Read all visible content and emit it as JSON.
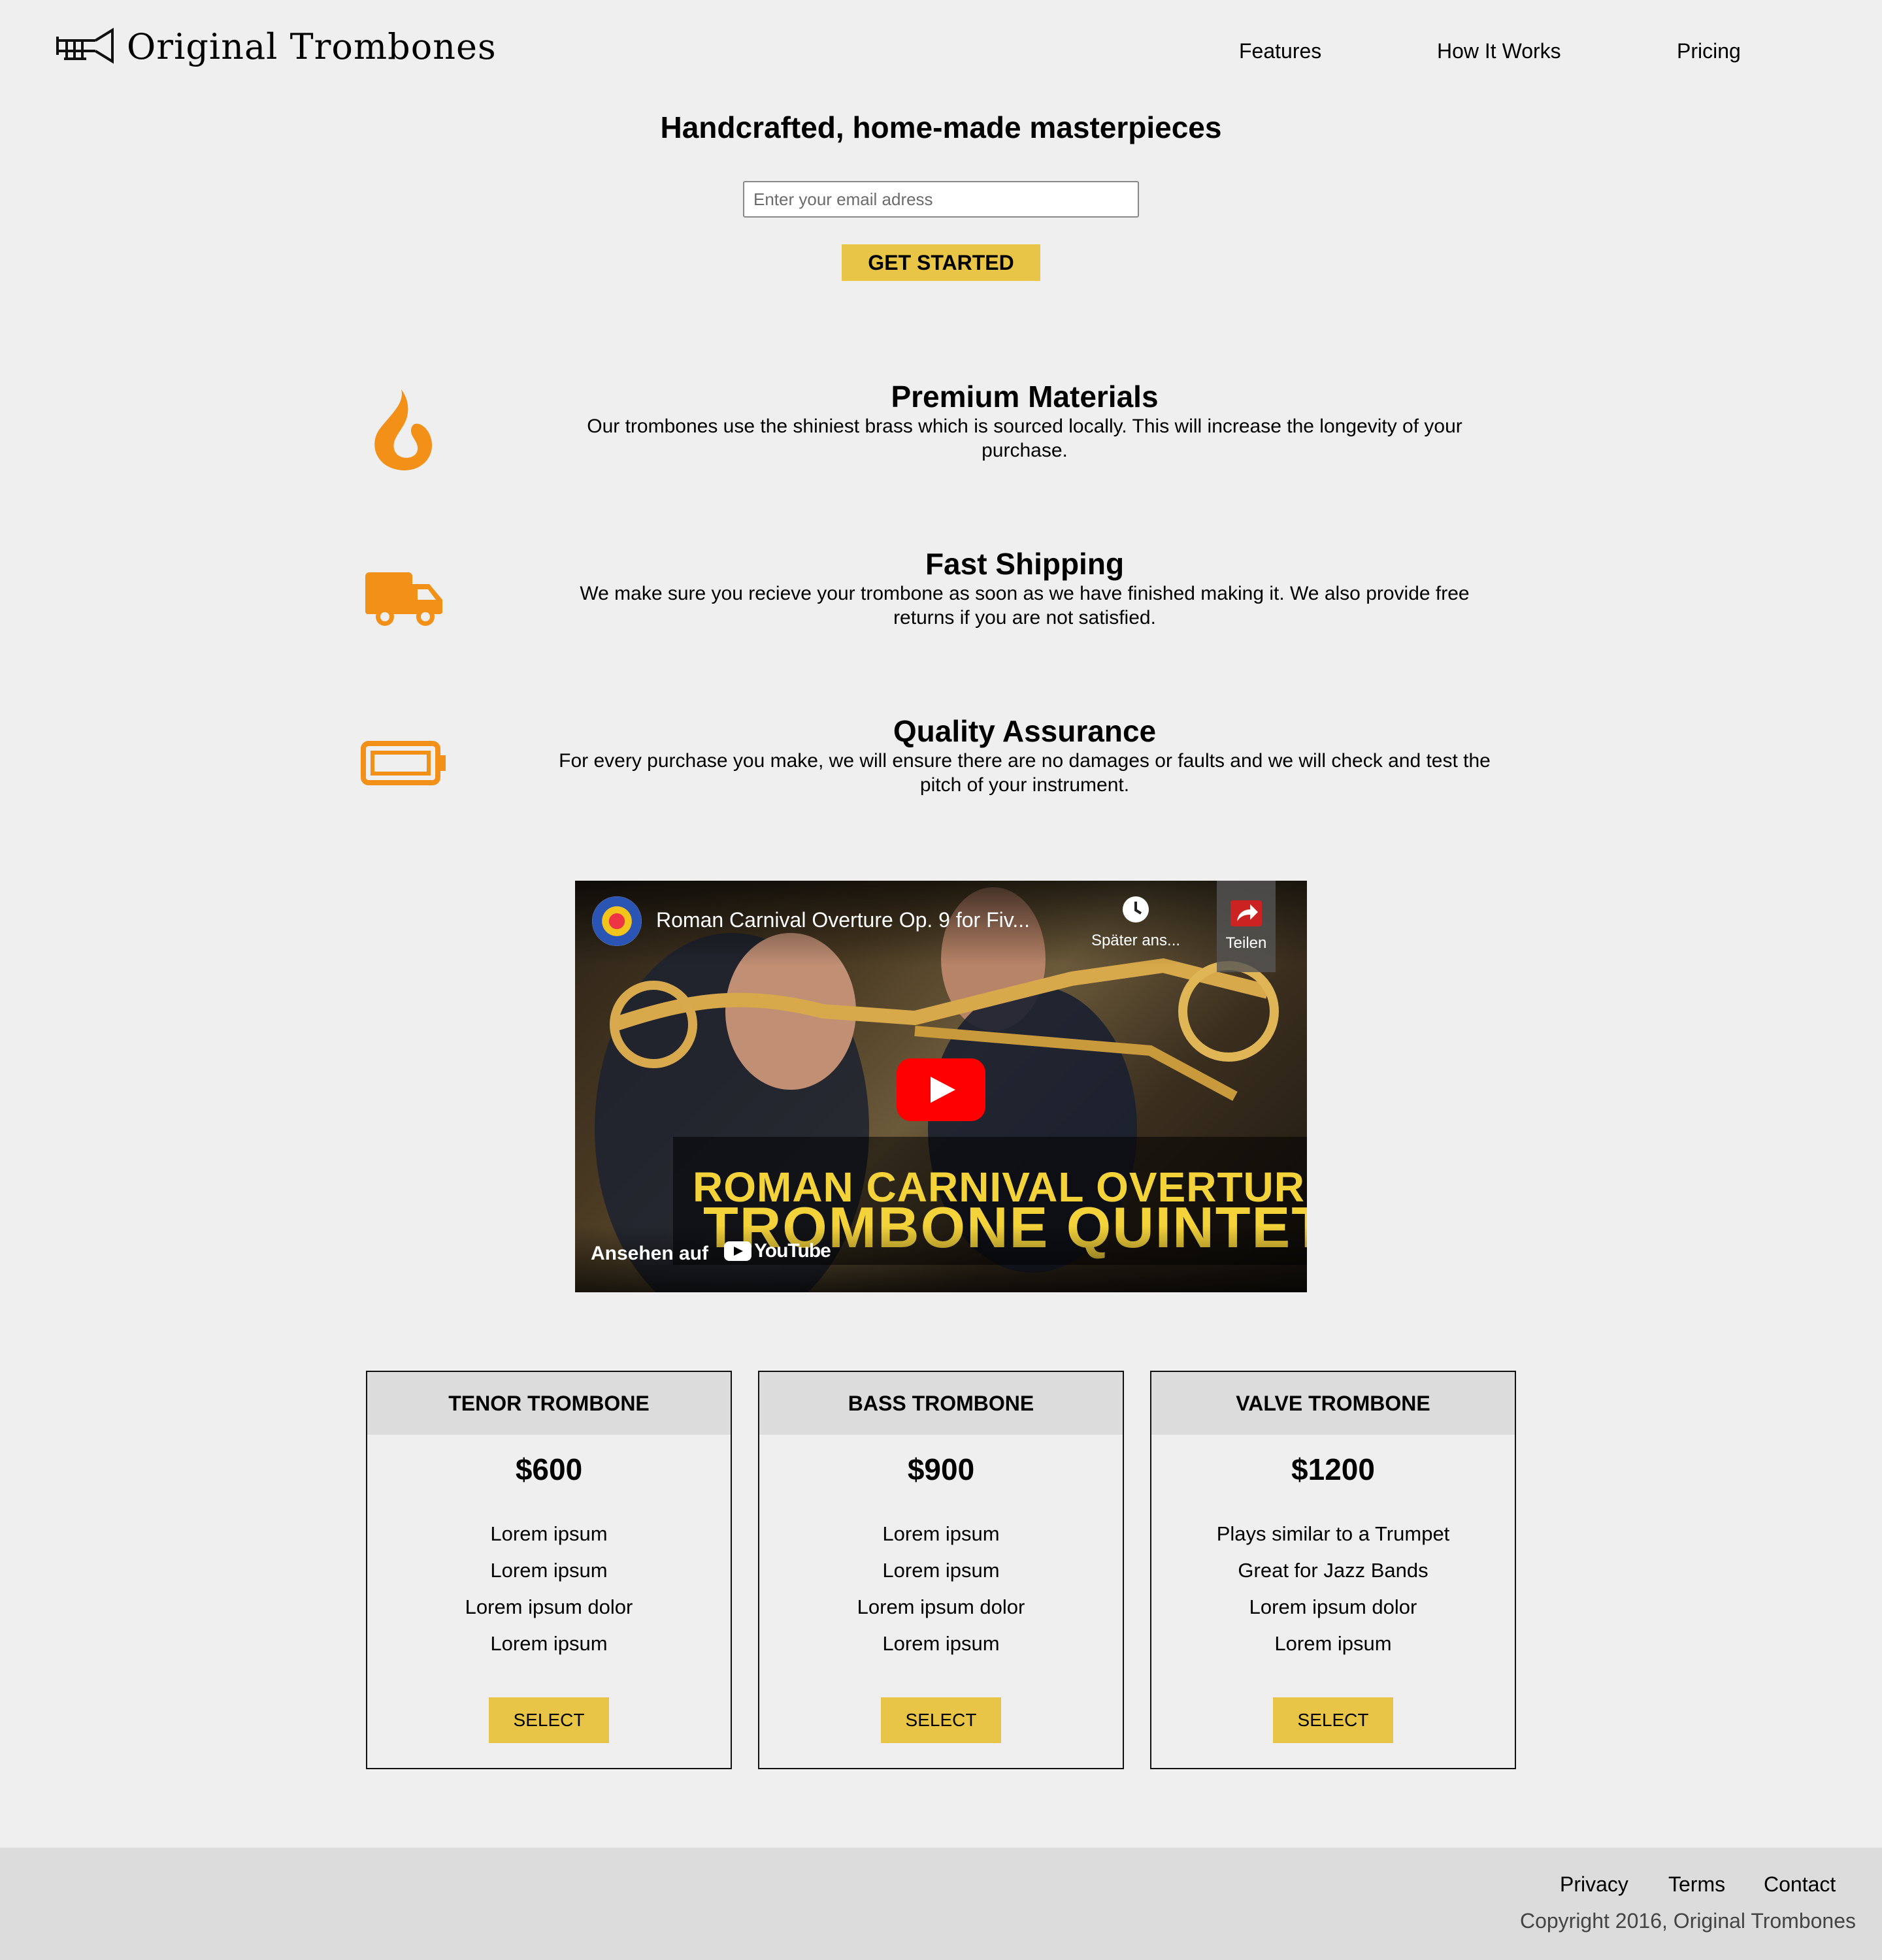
{
  "header": {
    "brand": "Original Trombones",
    "nav": [
      "Features",
      "How It Works",
      "Pricing"
    ]
  },
  "hero": {
    "title": "Handcrafted, home-made masterpieces",
    "email_placeholder": "Enter your email adress",
    "cta_label": "GET STARTED"
  },
  "features": [
    {
      "icon": "fire-icon",
      "title": "Premium Materials",
      "line1": "Our trombones use the shiniest brass which is sourced locally. This will increase the longevity of your",
      "line2": "purchase."
    },
    {
      "icon": "truck-icon",
      "title": "Fast Shipping",
      "line1": "We make sure you recieve your trombone as soon as we have finished making it. We also provide free",
      "line2": "returns if you are not satisfied."
    },
    {
      "icon": "battery-icon",
      "title": "Quality Assurance",
      "line1": "For every purchase you make, we will ensure there are no damages or faults and we will check and test the",
      "line2": "pitch of your instrument."
    }
  ],
  "video": {
    "title": "Roman Carnival Overture Op. 9 for Fiv...",
    "watch_later": "Später ans...",
    "share": "Teilen",
    "overlay_line1": "ROMAN CARNIVAL OVERTURE",
    "overlay_line2": "TROMBONE QUINTET",
    "watch_on": "Ansehen auf",
    "platform": "YouTube"
  },
  "pricing": [
    {
      "name": "TENOR TROMBONE",
      "price": "$600",
      "features": [
        "Lorem ipsum",
        "Lorem ipsum",
        "Lorem ipsum dolor",
        "Lorem ipsum"
      ],
      "button": "SELECT"
    },
    {
      "name": "BASS TROMBONE",
      "price": "$900",
      "features": [
        "Lorem ipsum",
        "Lorem ipsum",
        "Lorem ipsum dolor",
        "Lorem ipsum"
      ],
      "button": "SELECT"
    },
    {
      "name": "VALVE TROMBONE",
      "price": "$1200",
      "features": [
        "Plays similar to a Trumpet",
        "Great for Jazz Bands",
        "Lorem ipsum dolor",
        "Lorem ipsum"
      ],
      "button": "SELECT"
    }
  ],
  "footer": {
    "links": [
      "Privacy",
      "Terms",
      "Contact"
    ],
    "copyright": "Copyright 2016, Original Trombones"
  },
  "colors": {
    "background": "#efefef",
    "accent_button": "#e8c547",
    "icon_orange": "#f39017",
    "footer_bg": "#dcdcdc"
  }
}
